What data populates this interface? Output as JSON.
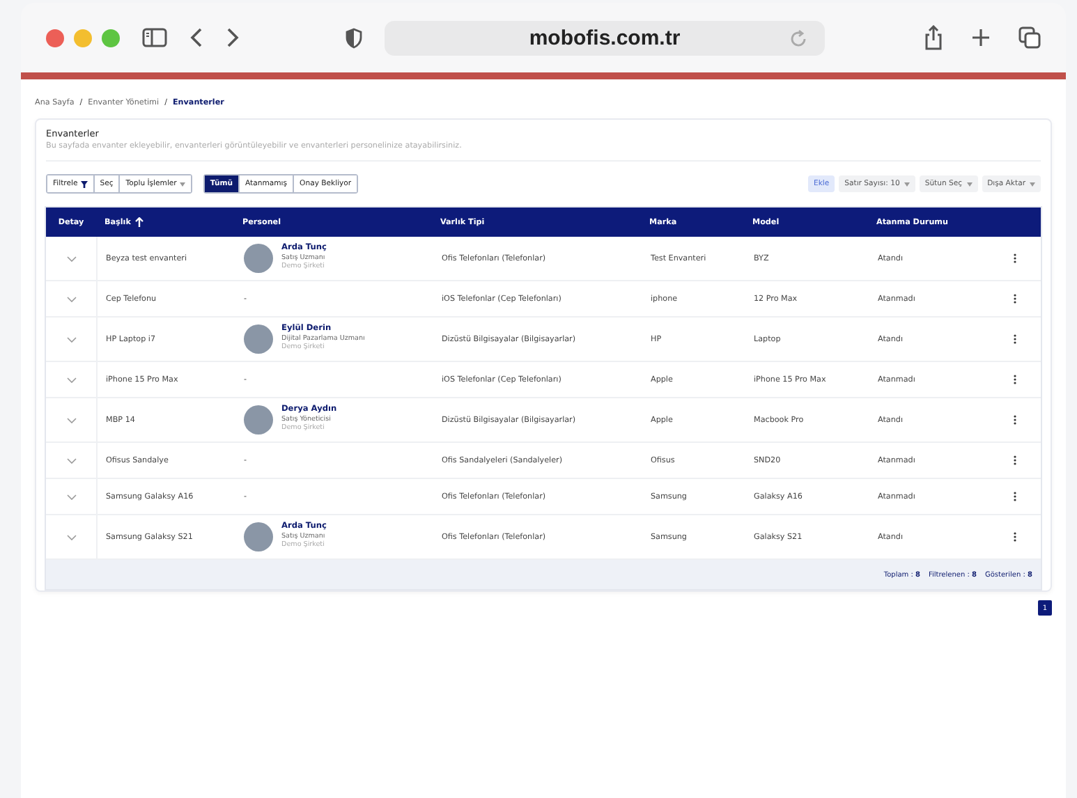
{
  "browser": {
    "address": "mobofis.com.tr"
  },
  "breadcrumb": [
    {
      "kind": "link",
      "label": "Ana Sayfa",
      "selected": false
    },
    {
      "kind": "separator",
      "label": "/"
    },
    {
      "kind": "link",
      "label": "Envanter Yönetimi",
      "selected": false
    },
    {
      "kind": "separator",
      "label": "/"
    },
    {
      "kind": "link",
      "label": "Envanterler",
      "selected": true
    }
  ],
  "page": {
    "title": "Envanterler",
    "description": "Bu sayfada envanter ekleyebilir, envanterleri görüntüleyebilir ve envanterleri personelinize atayabilirsiniz."
  },
  "toolbar": {
    "left": [
      {
        "label": "Filtrele",
        "kind": "filter"
      },
      {
        "label": "Seç",
        "kind": "plain"
      },
      {
        "label": "Toplu İşlemler",
        "kind": "dropdown"
      }
    ],
    "segments": [
      {
        "label": "Tümü",
        "selected": true
      },
      {
        "label": "Atanmamış",
        "selected": false
      },
      {
        "label": "Onay Bekliyor",
        "selected": false
      }
    ],
    "add": "Ekle",
    "right": [
      {
        "label": "Satır Sayısı: 10"
      },
      {
        "label": "Sütun Seç"
      },
      {
        "label": "Dışa Aktar"
      }
    ]
  },
  "table": {
    "columns": [
      "Detay",
      "Başlık",
      "Personel",
      "Varlık Tipi",
      "Marka",
      "Model",
      "Atanma Durumu"
    ],
    "rows": [
      {
        "title": "Beyza test envanteri",
        "person": {
          "name": "Arda Tunç",
          "role": "Satış Uzmanı",
          "company": "Demo Şirketi"
        },
        "type": "Ofis Telefonları (Telefonlar)",
        "brand": "Test Envanteri",
        "model": "BYZ",
        "status": "Atandı"
      },
      {
        "title": "Cep Telefonu",
        "person": null,
        "person_text": "-",
        "type": "iOS Telefonlar (Cep Telefonları)",
        "brand": "iphone",
        "model": "12 Pro Max",
        "status": "Atanmadı"
      },
      {
        "title": "HP Laptop i7",
        "person": {
          "name": "Eylül Derin",
          "role": "Dijital Pazarlama Uzmanı",
          "company": "Demo Şirketi"
        },
        "type": "Dizüstü Bilgisayalar (Bilgisayarlar)",
        "brand": "HP",
        "model": "Laptop",
        "status": "Atandı"
      },
      {
        "title": "iPhone 15 Pro Max",
        "person": null,
        "person_text": "-",
        "type": "iOS Telefonlar (Cep Telefonları)",
        "brand": "Apple",
        "model": "iPhone 15 Pro Max",
        "status": "Atanmadı"
      },
      {
        "title": "MBP 14",
        "person": {
          "name": "Derya Aydın",
          "role": "Satış Yöneticisi",
          "company": "Demo Şirketi"
        },
        "type": "Dizüstü Bilgisayalar (Bilgisayarlar)",
        "brand": "Apple",
        "model": "Macbook Pro",
        "status": "Atandı"
      },
      {
        "title": "Ofisus Sandalye",
        "person": null,
        "person_text": "-",
        "type": "Ofis Sandalyeleri (Sandalyeler)",
        "brand": "Ofisus",
        "model": "SND20",
        "status": "Atanmadı"
      },
      {
        "title": "Samsung Galaksy A16",
        "person": null,
        "person_text": "-",
        "type": "Ofis Telefonları (Telefonlar)",
        "brand": "Samsung",
        "model": "Galaksy A16",
        "status": "Atanmadı"
      },
      {
        "title": "Samsung Galaksy S21",
        "person": {
          "name": "Arda Tunç",
          "role": "Satış Uzmanı",
          "company": "Demo Şirketi"
        },
        "type": "Ofis Telefonları (Telefonlar)",
        "brand": "Samsung",
        "model": "Galaksy S21",
        "status": "Atandı"
      }
    ],
    "summary": [
      {
        "label": "Toplam :",
        "value": "8"
      },
      {
        "label": "Filtrelenen :",
        "value": "8"
      },
      {
        "label": "Gösterilen :",
        "value": "8"
      }
    ]
  },
  "pagination": [
    {
      "label": "1",
      "selected": true
    }
  ]
}
